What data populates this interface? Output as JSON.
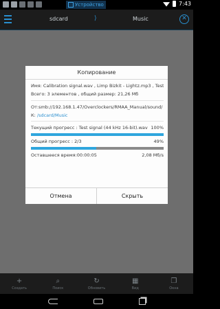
{
  "status_bar": {
    "badge_label": "Устройство",
    "time": "7:43"
  },
  "app_bar": {
    "breadcrumb_1": "sdcard",
    "breadcrumb_sep": "⟩",
    "breadcrumb_2": "Music"
  },
  "dialog": {
    "title": "Копирование",
    "name_line": "Имя: Calibration signal.wav , Limp Bizkit - Lightz.mp3 , Test si...",
    "total_line": "Всего: 3 элементов , общий размер: 21,26 Мб",
    "from_line": "От:smb://192.168.1.47/Overclockers/RMAA_Manual/sound/",
    "to_prefix": "К: ",
    "to_path": "/sdcard/Music",
    "current_label": "Текущий прогресс : Test signal (44 kHz 16-bit).wav",
    "current_percent": "100%",
    "current_progress": 1.0,
    "total_label": "Общий прогресс : 2/3",
    "total_percent": "49%",
    "total_progress": 0.49,
    "remaining_label": "Оставшееся время:00:00:05",
    "speed": "2,08 Мб/s",
    "cancel_label": "Отмена",
    "hide_label": "Скрыть"
  },
  "toolbar": [
    {
      "label": "Создать",
      "icon": "plus-icon"
    },
    {
      "label": "Поиск",
      "icon": "search-icon"
    },
    {
      "label": "Обновить",
      "icon": "refresh-icon"
    },
    {
      "label": "Вид",
      "icon": "grid-icon"
    },
    {
      "label": "Окна",
      "icon": "windows-icon"
    }
  ],
  "colors": {
    "accent": "#2fa6dd",
    "dim_background": "#6e6e6e",
    "bar_background": "#1c1c1c"
  }
}
